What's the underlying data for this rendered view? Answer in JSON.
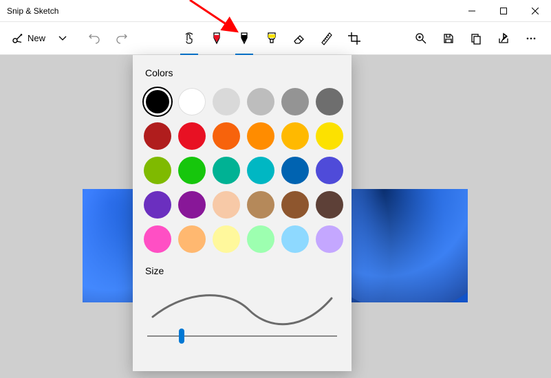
{
  "window": {
    "title": "Snip & Sketch"
  },
  "toolbar": {
    "new_label": "New"
  },
  "popup": {
    "colors_heading": "Colors",
    "size_heading": "Size",
    "slider_value": 18,
    "swatches": [
      {
        "name": "black",
        "hex": "#000000",
        "selected": true
      },
      {
        "name": "white",
        "hex": "#ffffff"
      },
      {
        "name": "silver",
        "hex": "#d9d9d9"
      },
      {
        "name": "gray-1",
        "hex": "#bdbdbd"
      },
      {
        "name": "gray-2",
        "hex": "#949494"
      },
      {
        "name": "gray-3",
        "hex": "#6e6e6e"
      },
      {
        "name": "dark-red",
        "hex": "#b01d1d"
      },
      {
        "name": "red",
        "hex": "#e81123"
      },
      {
        "name": "orange",
        "hex": "#f7630c"
      },
      {
        "name": "amber",
        "hex": "#ff8c00"
      },
      {
        "name": "gold",
        "hex": "#ffb900"
      },
      {
        "name": "yellow",
        "hex": "#fce100"
      },
      {
        "name": "lime",
        "hex": "#7fba00"
      },
      {
        "name": "green",
        "hex": "#16c60c"
      },
      {
        "name": "teal",
        "hex": "#00b294"
      },
      {
        "name": "cyan",
        "hex": "#00b7c3"
      },
      {
        "name": "blue",
        "hex": "#0063b1"
      },
      {
        "name": "indigo",
        "hex": "#4f4bd9"
      },
      {
        "name": "violet",
        "hex": "#6b2fbf"
      },
      {
        "name": "purple",
        "hex": "#881798"
      },
      {
        "name": "peach",
        "hex": "#f7c9a7"
      },
      {
        "name": "tan",
        "hex": "#b5895a"
      },
      {
        "name": "brown",
        "hex": "#8e562e"
      },
      {
        "name": "dark-brown",
        "hex": "#5d4037"
      },
      {
        "name": "pink",
        "hex": "#ff4fc4"
      },
      {
        "name": "light-orange",
        "hex": "#ffb870"
      },
      {
        "name": "light-yellow",
        "hex": "#fff89c"
      },
      {
        "name": "light-green",
        "hex": "#9dffb0"
      },
      {
        "name": "light-blue",
        "hex": "#8ed9ff"
      },
      {
        "name": "lavender",
        "hex": "#c4a7ff"
      }
    ]
  }
}
